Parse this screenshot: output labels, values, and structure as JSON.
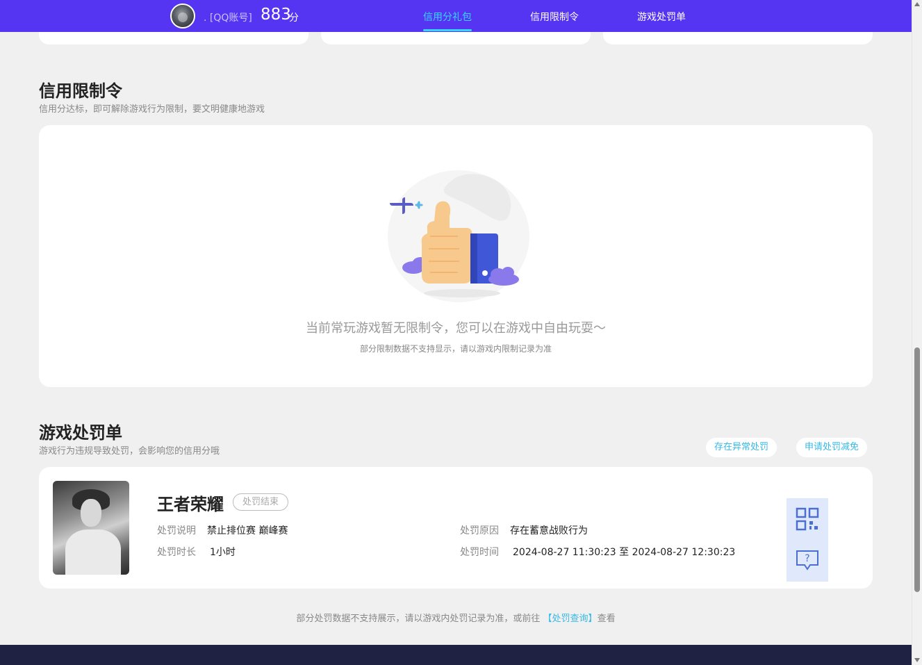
{
  "header": {
    "account_label": ". [QQ账号]",
    "score": "883",
    "score_unit": "分",
    "nav": [
      {
        "label": "信用分礼包",
        "active": true
      },
      {
        "label": "信用限制令",
        "active": false
      },
      {
        "label": "游戏处罚单",
        "active": false
      }
    ],
    "accent_color": "#5535f2",
    "active_color": "#34d8ff"
  },
  "restriction": {
    "title": "信用限制令",
    "subtitle": "信用分达标，即可解除游戏行为限制，要文明健康地游戏",
    "empty_main": "当前常玩游戏暂无限制令，您可以在游戏中自由玩耍～",
    "empty_sub": "部分限制数据不支持显示，请以游戏内限制记录为准",
    "illustration_icon": "thumbs-up-illustration"
  },
  "penalty": {
    "title": "游戏处罚单",
    "subtitle": "游戏行为违规导致处罚，会影响您的信用分哦",
    "btn_appeal": "存在异常处罚",
    "btn_reduce": "申请处罚减免",
    "item": {
      "game": "王者荣耀",
      "status": "处罚结束",
      "desc_label": "处罚说明",
      "desc_value": "禁止排位赛 巅峰赛",
      "duration_label": "处罚时长",
      "duration_value": "1小时",
      "reason_label": "处罚原因",
      "reason_value": "存在蓄意战败行为",
      "time_label": "处罚时间",
      "time_value": "2024-08-27 11:30:23 至 2024-08-27 12:30:23"
    },
    "side_icons": [
      "qr-code-icon",
      "help-chat-icon"
    ]
  },
  "footer": {
    "note_prefix": "部分处罚数据不支持展示，请以游戏内处罚记录为准，或前往 ",
    "note_link": "【处罚查询】",
    "note_suffix": "查看"
  }
}
